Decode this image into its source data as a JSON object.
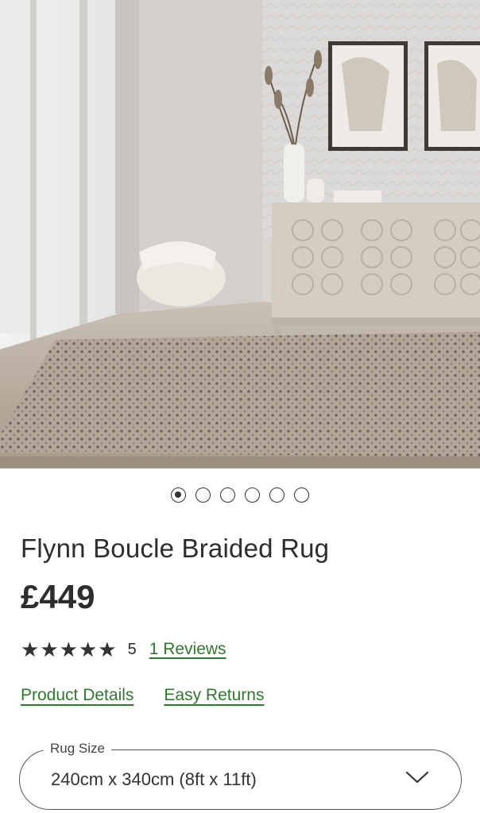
{
  "product": {
    "title": "Flynn Boucle Braided Rug",
    "price": "£449",
    "rating_value": "5",
    "rating_stars": 5,
    "reviews_label": "1 Reviews"
  },
  "gallery": {
    "total_images": 6,
    "active_index": 0
  },
  "links": {
    "product_details": "Product Details",
    "easy_returns": "Easy Returns"
  },
  "size_select": {
    "label": "Rug Size",
    "value": "240cm x 340cm (8ft x 11ft)"
  },
  "colors": {
    "link_green": "#2d7a2d",
    "text_dark": "#2d2d2d"
  },
  "icons": {
    "rating": "star-icon",
    "dropdown": "chevron-down-icon"
  }
}
